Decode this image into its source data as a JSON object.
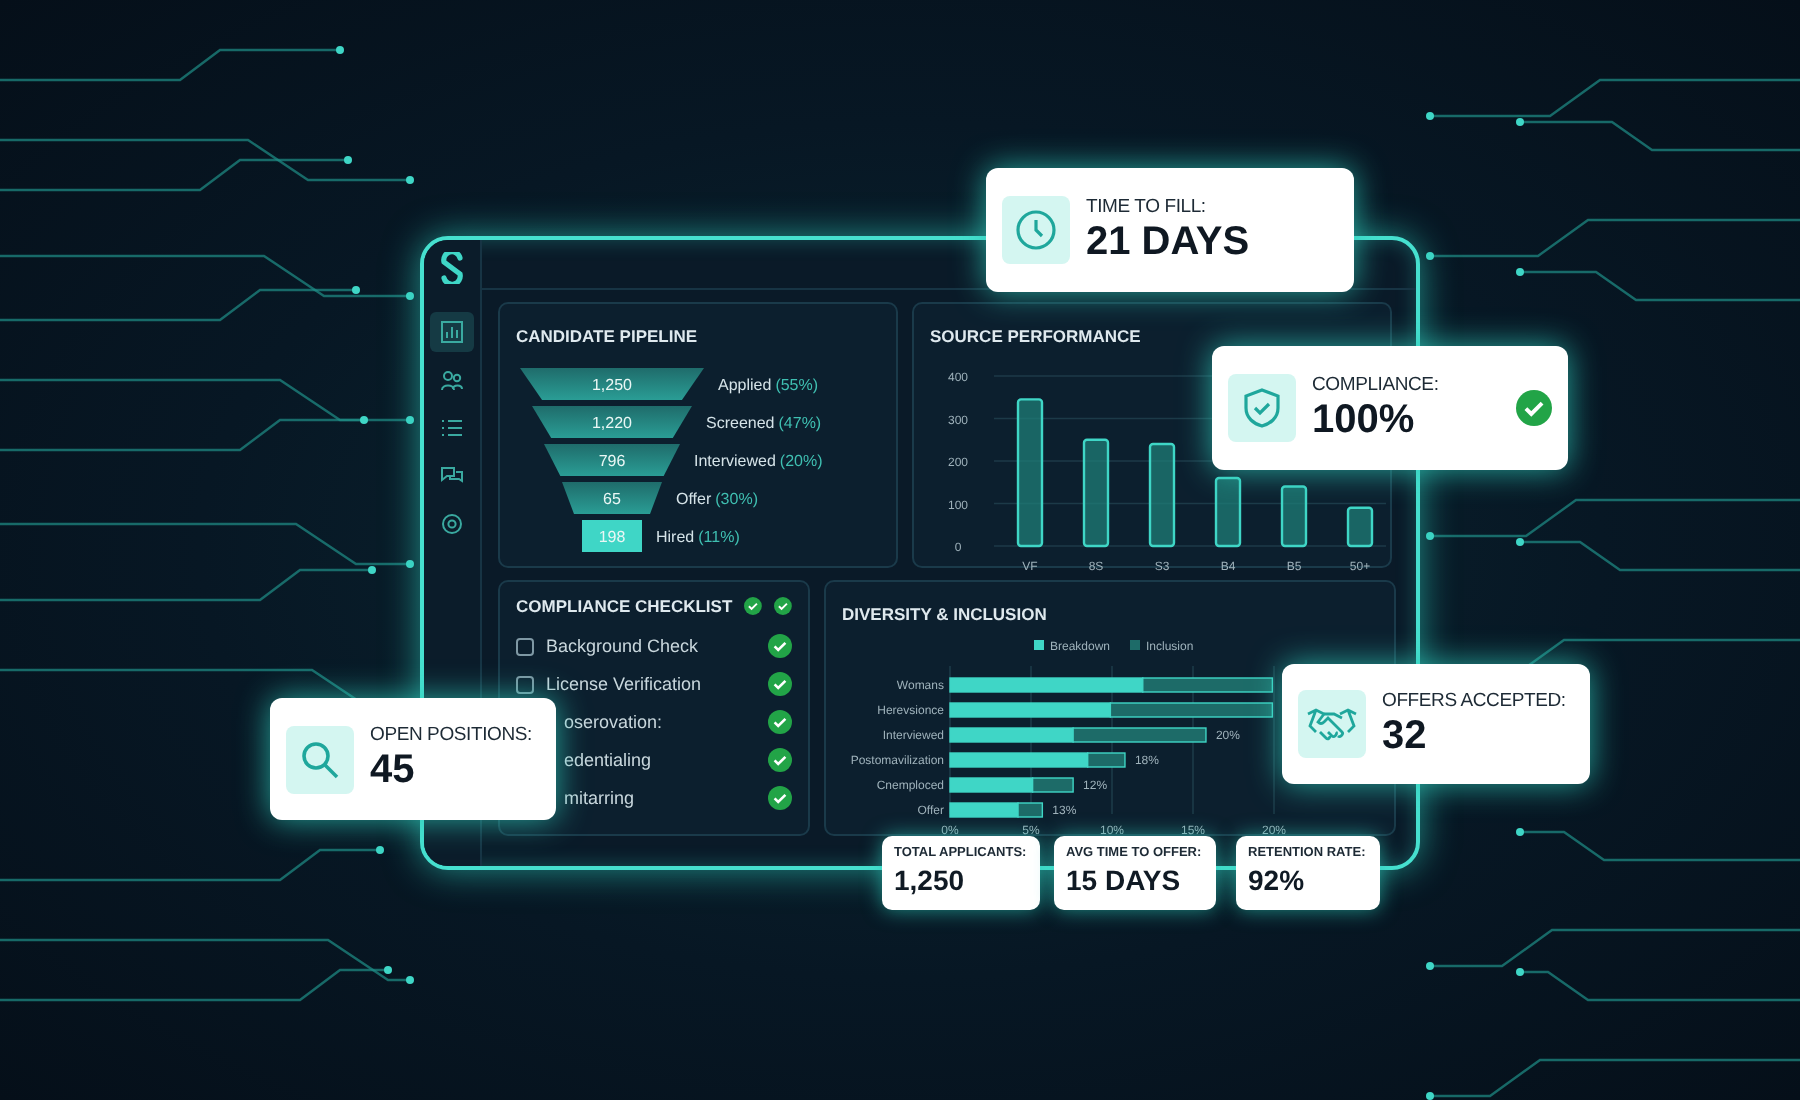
{
  "sidebar": {
    "items": [
      {
        "kind": "chart",
        "selected": true
      },
      {
        "kind": "users",
        "selected": false
      },
      {
        "kind": "list",
        "selected": false
      },
      {
        "kind": "chat",
        "selected": false
      },
      {
        "kind": "gear",
        "selected": false
      }
    ]
  },
  "pipeline": {
    "title": "CANDIDATE PIPELINE",
    "stages": [
      {
        "count": "1,250",
        "label": "Applied",
        "percent": "(55%)"
      },
      {
        "count": "1,220",
        "label": "Screened",
        "percent": "(47%)"
      },
      {
        "count": "796",
        "label": "Interviewed",
        "percent": "(20%)"
      },
      {
        "count": "65",
        "label": "Offer",
        "percent": "(30%)"
      },
      {
        "count": "198",
        "label": "Hired",
        "percent": "(11%)"
      }
    ]
  },
  "source_performance": {
    "title": "SOURCE PERFORMANCE",
    "chart_data": {
      "type": "bar",
      "categories": [
        "VF",
        "8S",
        "S3",
        "B4",
        "B5",
        "50+"
      ],
      "values": [
        345,
        250,
        240,
        160,
        140,
        90
      ],
      "grid": true,
      "ylim": [
        0,
        400
      ],
      "yticks": [
        0,
        100,
        200,
        300,
        400
      ]
    }
  },
  "compliance_checklist": {
    "title": "COMPLIANCE CHECKLIST",
    "header_status": [
      {
        "done": true
      },
      {
        "done": true
      }
    ],
    "items": [
      {
        "label": "Background Check",
        "checked": false,
        "done": true
      },
      {
        "label": "License Verification",
        "checked": false,
        "done": true
      },
      {
        "label": "oserovation:",
        "done": true
      },
      {
        "label": "edentialing",
        "done": true
      },
      {
        "label": "mitarring",
        "done": true
      }
    ]
  },
  "diversity": {
    "title": "DIVERSITY & INCLUSION",
    "chart_data": {
      "type": "bar",
      "orientation": "horizontal",
      "stacked": true,
      "grid": true,
      "legend": "top",
      "categories": [
        "Womans",
        "Herevsionce",
        "Interviewed",
        "Postomavilization",
        "Cnemploced",
        "Offer"
      ],
      "series": [
        {
          "name": "Breakdown",
          "color": "#3fd6c6",
          "values": [
            11.9,
            9.9,
            7.6,
            8.5,
            5.1,
            4.2
          ]
        },
        {
          "name": "Inclusion",
          "color": "#1d6b68",
          "values": [
            8.0,
            10.0,
            8.2,
            2.3,
            2.5,
            1.5
          ]
        }
      ],
      "xlim": [
        0,
        20
      ],
      "xticks": [
        {
          "value": 0,
          "label": "0%"
        },
        {
          "value": 5,
          "label": "5%"
        },
        {
          "value": 10,
          "label": "10%"
        },
        {
          "value": 15,
          "label": "15%"
        },
        {
          "value": 20,
          "label": "20%"
        }
      ],
      "value_labels": [
        null,
        null,
        "20%",
        "18%",
        "12%",
        "13%"
      ]
    }
  },
  "stats": [
    {
      "label": "TOTAL APPLICANTS:",
      "value": "1,250"
    },
    {
      "label": "AVG TIME TO OFFER:",
      "value": "15 DAYS"
    },
    {
      "label": "RETENTION RATE:",
      "value": "92%"
    }
  ],
  "floating_cards": [
    {
      "kind": "clock",
      "label": "TIME TO FILL:",
      "value": "21 DAYS"
    },
    {
      "kind": "shield",
      "label": "COMPLIANCE:",
      "value": "100%",
      "done": true
    },
    {
      "kind": "search",
      "label": "OPEN POSITIONS:",
      "value": "45"
    },
    {
      "kind": "handshake",
      "label": "OFFERS ACCEPTED:",
      "value": "32"
    }
  ]
}
